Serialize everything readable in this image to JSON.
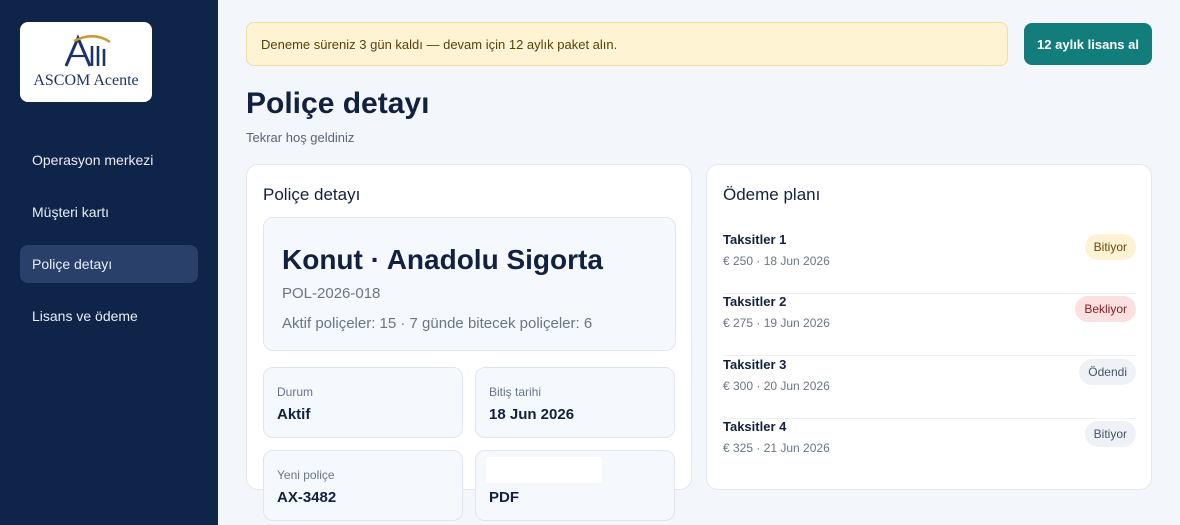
{
  "brand": {
    "name": "ASCOM Acente",
    "logo_icon": "ascom-logo-icon"
  },
  "sidebar": {
    "items": [
      {
        "label": "Operasyon merkezi",
        "active": false
      },
      {
        "label": "Müşteri kartı",
        "active": false
      },
      {
        "label": "Poliçe detayı",
        "active": true
      },
      {
        "label": "Lisans ve ödeme",
        "active": false
      }
    ]
  },
  "banner": {
    "text": "Deneme süreniz 3 gün kaldı — devam için 12 aylık paket alın.",
    "button": "12 aylık lisans al"
  },
  "header": {
    "title": "Poliçe detayı",
    "subtitle": "Tekrar hoş geldiniz"
  },
  "policy": {
    "card_title": "Poliçe detayı",
    "title": "Konut · Anadolu Sigorta",
    "code": "POL-2026-018",
    "stats": "Aktif poliçeler: 15 · 7 günde bitecek poliçeler: 6",
    "fields": [
      {
        "label": "Durum",
        "value": "Aktif"
      },
      {
        "label": "Bitiş tarihi",
        "value": "18 Jun 2026"
      },
      {
        "label": "Yeni poliçe",
        "value": "AX-3482"
      },
      {
        "label": "",
        "value": "PDF"
      }
    ]
  },
  "payment_plan": {
    "title": "Ödeme planı",
    "items": [
      {
        "name": "Taksitler 1",
        "detail": "€ 250 · 18 Jun 2026",
        "status": "Bitiyor",
        "status_color": "#fdf2d4"
      },
      {
        "name": "Taksitler 2",
        "detail": "€ 275 · 19 Jun 2026",
        "status": "Bekliyor",
        "status_color": "#fbe0e2"
      },
      {
        "name": "Taksitler 3",
        "detail": "€ 300 · 20 Jun 2026",
        "status": "Ödendi",
        "status_color": "#eef2f7"
      },
      {
        "name": "Taksitler 4",
        "detail": "€ 325 · 21 Jun 2026",
        "status": "Bitiyor",
        "status_color": "#eef2f7"
      }
    ]
  },
  "colors": {
    "sidebar_bg": "#0f2449",
    "sidebar_active": "#29406a",
    "accent": "#137d7c",
    "banner_bg": "#fef4d4"
  }
}
